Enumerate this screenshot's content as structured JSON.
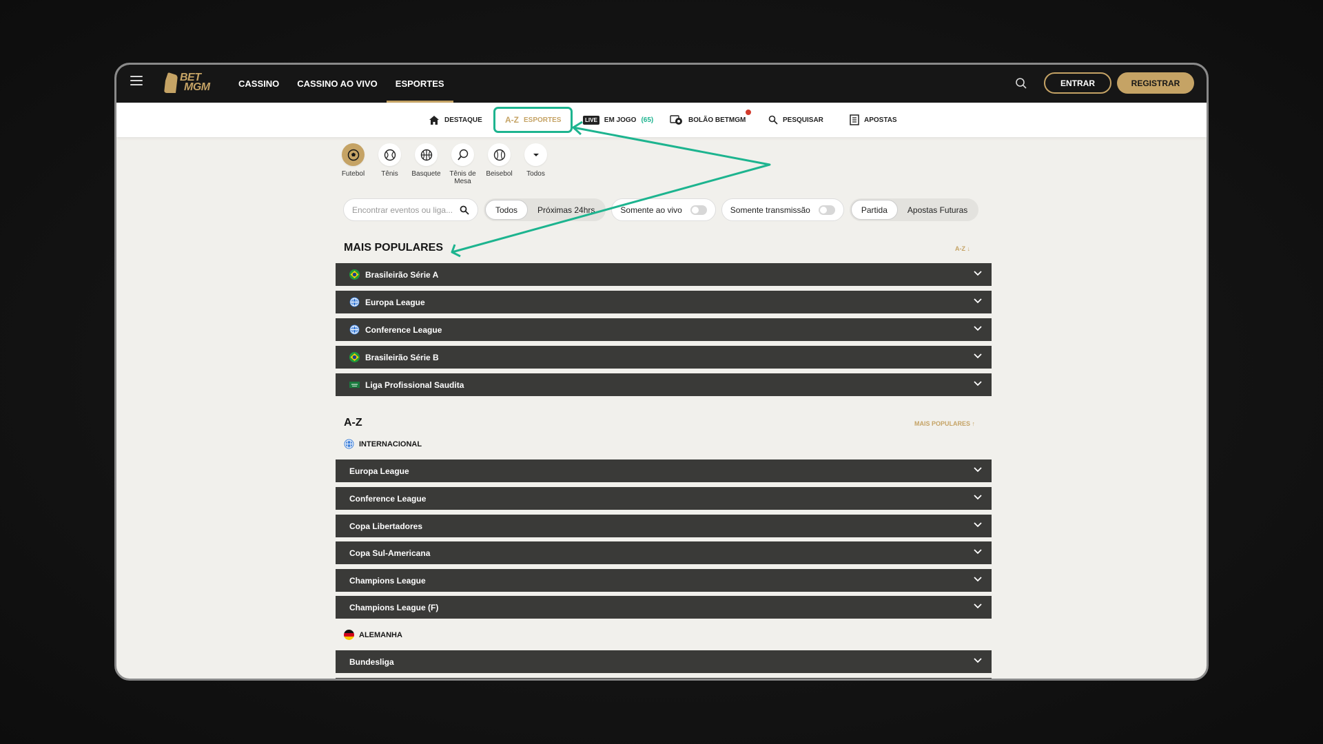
{
  "topnav": {
    "menu_icon": "hamburger-menu-icon",
    "logo": "BETMGM",
    "items": [
      "CASSINO",
      "CASSINO AO VIVO",
      "ESPORTES"
    ],
    "login_label": "ENTRAR",
    "register_label": "REGISTRAR"
  },
  "subnav": {
    "destaque": "DESTAQUE",
    "az_prefix": "A-Z",
    "esportes": "ESPORTES",
    "live_badge": "LIVE",
    "em_jogo": "EM JOGO",
    "em_jogo_count": "(65)",
    "bolao": "BOLÃO BETMGM",
    "pesquisar": "PESQUISAR",
    "apostas": "APOSTAS"
  },
  "sports": [
    {
      "label": "Futebol",
      "icon": "soccer-ball-icon"
    },
    {
      "label": "Tênis",
      "icon": "tennis-ball-icon"
    },
    {
      "label": "Basquete",
      "icon": "basketball-icon"
    },
    {
      "label": "Tênis de Mesa",
      "icon": "ping-pong-icon"
    },
    {
      "label": "Beisebol",
      "icon": "baseball-icon"
    },
    {
      "label": "Todos",
      "icon": "caret-down-icon"
    }
  ],
  "filters": {
    "search_placeholder": "Encontrar eventos ou liga...",
    "time_options": [
      "Todos",
      "Próximas 24hrs"
    ],
    "live_only": "Somente ao vivo",
    "stream_only": "Somente transmissão",
    "market_options": [
      "Partida",
      "Apostas Futuras"
    ]
  },
  "popular": {
    "title": "MAIS POPULARES",
    "sort_label": "A-Z ↓",
    "leagues": [
      {
        "name": "Brasileirão Série A",
        "flag": "brazil"
      },
      {
        "name": "Europa League",
        "flag": "globe"
      },
      {
        "name": "Conference League",
        "flag": "globe"
      },
      {
        "name": "Brasileirão Série B",
        "flag": "brazil"
      },
      {
        "name": "Liga Profissional Saudita",
        "flag": "saudi"
      }
    ]
  },
  "az": {
    "title": "A-Z",
    "sort_label": "MAIS POPULARES ↑",
    "groups": [
      {
        "country": "INTERNACIONAL",
        "leagues": [
          "Europa League",
          "Conference League",
          "Copa Libertadores",
          "Copa Sul-Americana",
          "Champions League",
          "Champions League (F)"
        ]
      },
      {
        "country": "ALEMANHA",
        "leagues": [
          "Bundesliga"
        ]
      }
    ]
  },
  "colors": {
    "accent_gold": "#c5a365",
    "highlight_teal": "#1db48f",
    "row_dark": "#3a3a38",
    "topbar": "#161616"
  }
}
